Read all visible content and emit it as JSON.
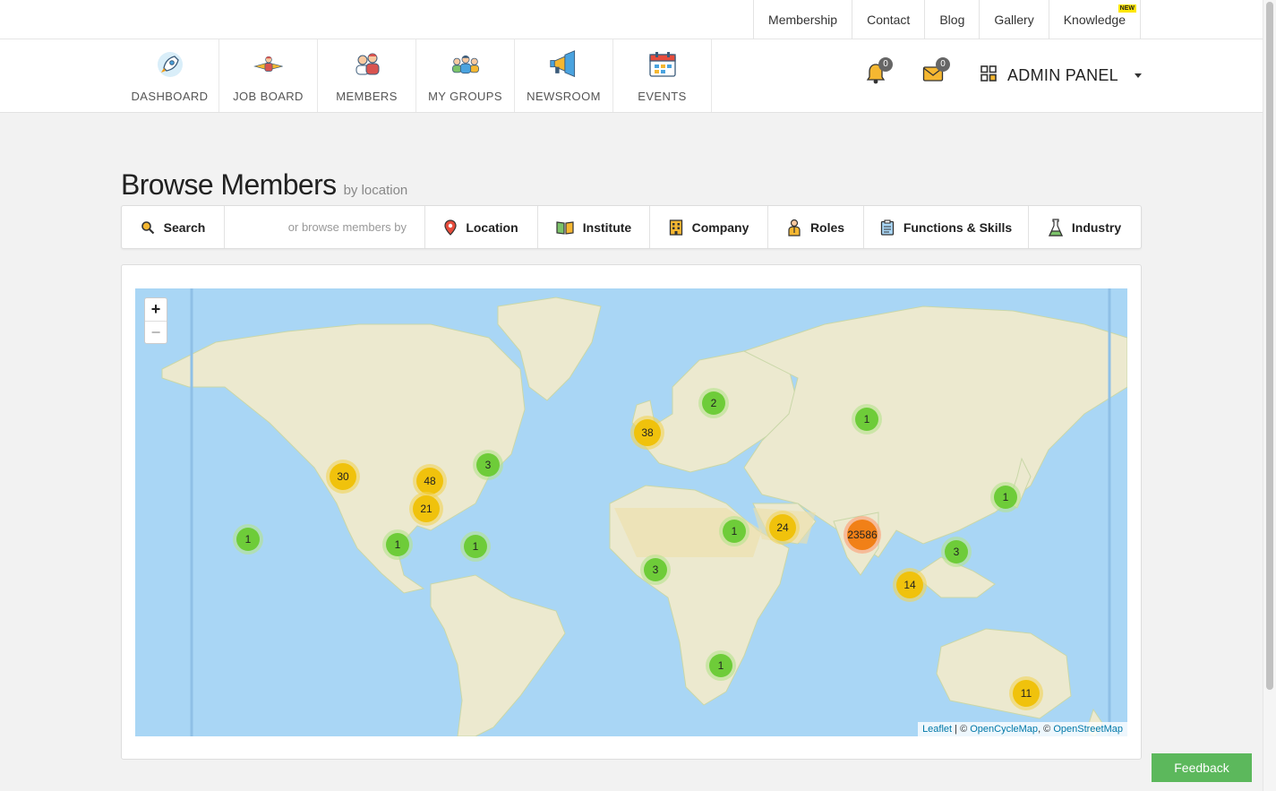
{
  "toplinks": [
    {
      "label": "Membership"
    },
    {
      "label": "Contact"
    },
    {
      "label": "Blog"
    },
    {
      "label": "Gallery"
    },
    {
      "label": "Knowledge",
      "badge": "NEW"
    }
  ],
  "nav": [
    {
      "label": "DASHBOARD",
      "icon": "rocket-icon"
    },
    {
      "label": "JOB BOARD",
      "icon": "job-board-icon"
    },
    {
      "label": "MEMBERS",
      "icon": "members-icon"
    },
    {
      "label": "MY GROUPS",
      "icon": "groups-icon"
    },
    {
      "label": "NEWSROOM",
      "icon": "megaphone-icon"
    },
    {
      "label": "EVENTS",
      "icon": "calendar-icon"
    }
  ],
  "notifications": {
    "bell_count": "0",
    "mail_count": "0"
  },
  "admin_panel": {
    "label": "ADMIN PANEL"
  },
  "heading": {
    "title": "Browse Members",
    "subtitle": "by location"
  },
  "filters": {
    "search": "Search",
    "hint": "or browse members by",
    "items": [
      {
        "label": "Location",
        "icon": "map-pin-icon"
      },
      {
        "label": "Institute",
        "icon": "book-icon"
      },
      {
        "label": "Company",
        "icon": "building-icon"
      },
      {
        "label": "Roles",
        "icon": "person-icon"
      },
      {
        "label": "Functions & Skills",
        "icon": "clipboard-icon"
      },
      {
        "label": "Industry",
        "icon": "flask-icon"
      }
    ]
  },
  "map": {
    "zoom_in": "+",
    "zoom_out": "−",
    "attribution": {
      "leaflet": "Leaflet",
      "sep1": " | © ",
      "ocm": "OpenCycleMap",
      "sep2": ", © ",
      "osm": "OpenStreetMap"
    },
    "clusters": [
      "1",
      "30",
      "48",
      "21",
      "3",
      "1",
      "1",
      "38",
      "2",
      "1",
      "1",
      "3",
      "1",
      "24",
      "23586",
      "3",
      "14",
      "1",
      "11"
    ]
  },
  "feedback": "Feedback",
  "colors": {
    "cluster_small": "#6ecc39",
    "cluster_medium": "#f0c20c",
    "cluster_large": "#f18017",
    "feedback": "#5cb85c",
    "link": "#0078a8"
  }
}
